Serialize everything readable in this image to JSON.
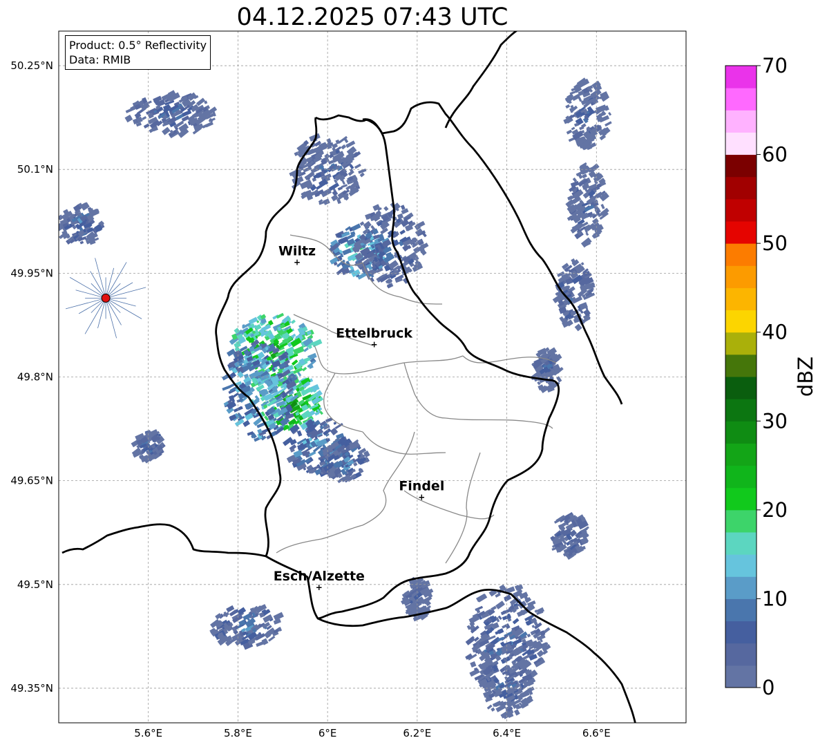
{
  "title": "04.12.2025 07:43 UTC",
  "info": {
    "product": "Product: 0.5° Reflectivity",
    "data": "Data: RMIB"
  },
  "axes": {
    "lon_ticks": [
      {
        "value": 5.6,
        "label": "5.6°E"
      },
      {
        "value": 5.8,
        "label": "5.8°E"
      },
      {
        "value": 6.0,
        "label": "6°E"
      },
      {
        "value": 6.2,
        "label": "6.2°E"
      },
      {
        "value": 6.4,
        "label": "6.4°E"
      },
      {
        "value": 6.6,
        "label": "6.6°E"
      }
    ],
    "lat_ticks": [
      {
        "value": 50.25,
        "label": "50.25°N"
      },
      {
        "value": 50.1,
        "label": "50.1°N"
      },
      {
        "value": 49.95,
        "label": "49.95°N"
      },
      {
        "value": 49.8,
        "label": "49.8°N"
      },
      {
        "value": 49.65,
        "label": "49.65°N"
      },
      {
        "value": 49.5,
        "label": "49.5°N"
      },
      {
        "value": 49.35,
        "label": "49.35°N"
      }
    ],
    "lon_range": [
      5.4,
      6.8
    ],
    "lat_range": [
      49.3,
      50.3
    ],
    "grid": true
  },
  "cities": [
    {
      "name": "Wiltz",
      "lon": 5.932,
      "lat": 49.966
    },
    {
      "name": "Ettelbruck",
      "lon": 6.104,
      "lat": 49.847
    },
    {
      "name": "Findel",
      "lon": 6.21,
      "lat": 49.626
    },
    {
      "name": "Esch/Alzette",
      "lon": 5.981,
      "lat": 49.496
    }
  ],
  "radar_site": {
    "lon": 5.505,
    "lat": 49.914
  },
  "colorbar": {
    "label": "dBZ",
    "min": 0,
    "max": 70,
    "ticks": [
      "0",
      "10",
      "20",
      "30",
      "40",
      "50",
      "60",
      "70"
    ],
    "colors": [
      "#6374a4",
      "#56689f",
      "#455f9f",
      "#4a76ad",
      "#5a9cc8",
      "#66c4dd",
      "#5cd6c0",
      "#3dd46a",
      "#11c91c",
      "#10b51b",
      "#13a517",
      "#0f8c13",
      "#0c7611",
      "#0a5e0e",
      "#45760a",
      "#aab00a",
      "#fcd500",
      "#fcb500",
      "#fc9b00",
      "#fc7c00",
      "#e50400",
      "#c00000",
      "#a10000",
      "#7b0000",
      "#ffe0ff",
      "#ffb2ff",
      "#ff69ff",
      "#ea33ea"
    ]
  },
  "echoes": [
    {
      "lon": 5.88,
      "lat": 49.84,
      "rlon": 0.1,
      "rlat": 0.05,
      "dbz": 22
    },
    {
      "lon": 5.92,
      "lat": 49.76,
      "rlon": 0.07,
      "rlat": 0.04,
      "dbz": 24
    },
    {
      "lon": 5.85,
      "lat": 49.78,
      "rlon": 0.08,
      "rlat": 0.07,
      "dbz": 15
    },
    {
      "lon": 5.98,
      "lat": 49.7,
      "rlon": 0.07,
      "rlat": 0.04,
      "dbz": 11
    },
    {
      "lon": 6.04,
      "lat": 49.68,
      "rlon": 0.05,
      "rlat": 0.03,
      "dbz": 9
    },
    {
      "lon": 6.07,
      "lat": 49.98,
      "rlon": 0.06,
      "rlat": 0.04,
      "dbz": 15
    },
    {
      "lon": 6.0,
      "lat": 50.1,
      "rlon": 0.08,
      "rlat": 0.05,
      "dbz": 6
    },
    {
      "lon": 6.14,
      "lat": 49.99,
      "rlon": 0.08,
      "rlat": 0.06,
      "dbz": 7
    },
    {
      "lon": 6.54,
      "lat": 49.57,
      "rlon": 0.04,
      "rlat": 0.03,
      "dbz": 6
    },
    {
      "lon": 6.4,
      "lat": 49.42,
      "rlon": 0.09,
      "rlat": 0.08,
      "dbz": 7
    },
    {
      "lon": 6.4,
      "lat": 49.36,
      "rlon": 0.06,
      "rlat": 0.05,
      "dbz": 6
    },
    {
      "lon": 6.58,
      "lat": 50.18,
      "rlon": 0.05,
      "rlat": 0.05,
      "dbz": 5
    },
    {
      "lon": 6.58,
      "lat": 50.05,
      "rlon": 0.04,
      "rlat": 0.06,
      "dbz": 6
    },
    {
      "lon": 6.55,
      "lat": 49.92,
      "rlon": 0.04,
      "rlat": 0.05,
      "dbz": 7
    },
    {
      "lon": 6.49,
      "lat": 49.81,
      "rlon": 0.03,
      "rlat": 0.03,
      "dbz": 5
    },
    {
      "lon": 5.65,
      "lat": 50.18,
      "rlon": 0.1,
      "rlat": 0.03,
      "dbz": 6
    },
    {
      "lon": 5.6,
      "lat": 49.7,
      "rlon": 0.03,
      "rlat": 0.02,
      "dbz": 8
    },
    {
      "lon": 5.82,
      "lat": 49.44,
      "rlon": 0.08,
      "rlat": 0.03,
      "dbz": 8
    },
    {
      "lon": 6.2,
      "lat": 49.48,
      "rlon": 0.03,
      "rlat": 0.03,
      "dbz": 5
    },
    {
      "lon": 5.45,
      "lat": 50.02,
      "rlon": 0.05,
      "rlat": 0.03,
      "dbz": 7
    }
  ]
}
